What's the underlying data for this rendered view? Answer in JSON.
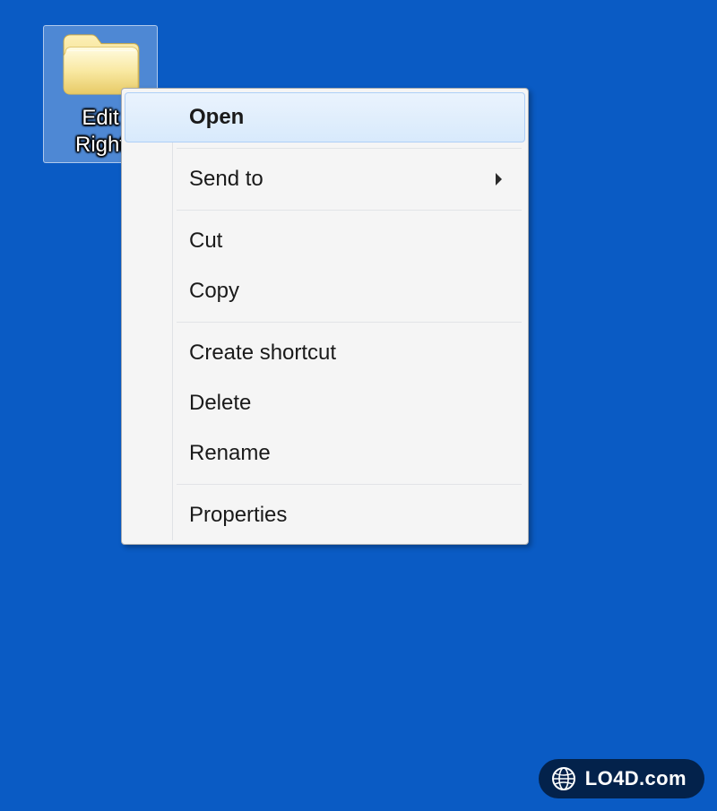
{
  "desktop": {
    "folder_icon": "folder-icon",
    "folder_label": "Edit\nRight"
  },
  "menu": {
    "open": "Open",
    "send_to": "Send to",
    "cut": "Cut",
    "copy": "Copy",
    "create_shortcut": "Create shortcut",
    "delete": "Delete",
    "rename": "Rename",
    "properties": "Properties"
  },
  "watermark": {
    "text": "LO4D.com"
  }
}
